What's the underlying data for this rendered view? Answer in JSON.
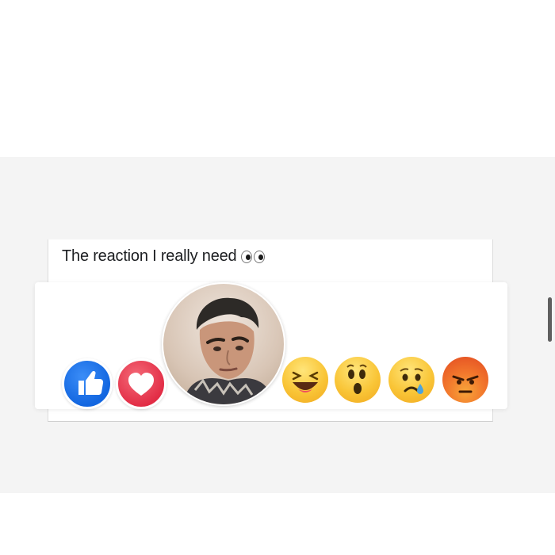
{
  "post": {
    "text": "The reaction I really need",
    "trailing_icon": "eyes-icon"
  },
  "reactions": [
    {
      "name": "like",
      "icon": "thumbs-up-icon",
      "color": "#1877F2"
    },
    {
      "name": "love",
      "icon": "heart-icon",
      "color": "#F33E58"
    },
    {
      "name": "custom",
      "icon": "person-face-avatar",
      "color": "#D8C5B5"
    },
    {
      "name": "haha",
      "icon": "laughing-face-icon",
      "color": "#F7B125"
    },
    {
      "name": "wow",
      "icon": "surprised-face-icon",
      "color": "#F7B125"
    },
    {
      "name": "sad",
      "icon": "crying-face-icon",
      "color": "#F7B125"
    },
    {
      "name": "angry",
      "icon": "angry-face-icon",
      "color": "#E9710F"
    }
  ],
  "colors": {
    "background": "#FFFFFF",
    "band": "#F4F4F4",
    "text": "#1C1E21"
  }
}
